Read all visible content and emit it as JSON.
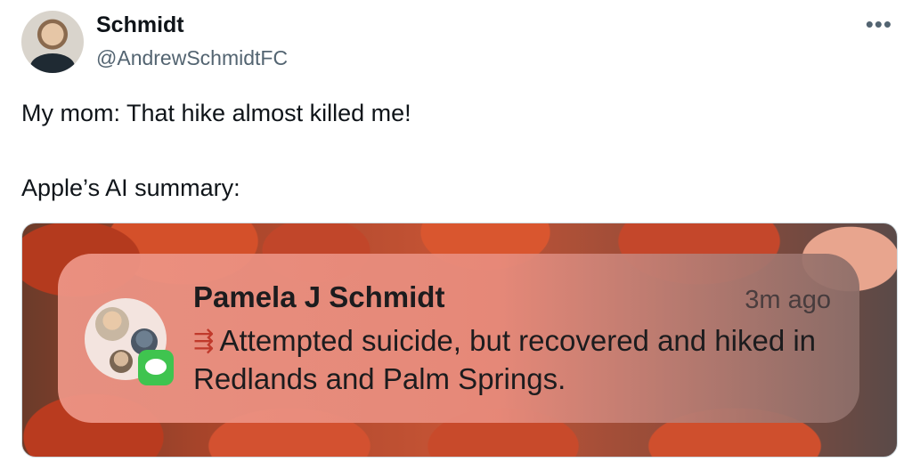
{
  "tweet": {
    "display_name": "Schmidt",
    "handle": "@AndrewSchmidtFC",
    "more_icon": "ellipsis-icon",
    "lines": [
      "My mom: That hike almost killed me!",
      "Apple’s AI summary:"
    ]
  },
  "notification": {
    "sender": "Pamela J Schmidt",
    "time": "3m ago",
    "summary_icon": "summary-icon",
    "summary": "Attempted suicide, but recovered and hiked in Redlands and Palm Springs.",
    "app_icon": "messages-icon"
  }
}
